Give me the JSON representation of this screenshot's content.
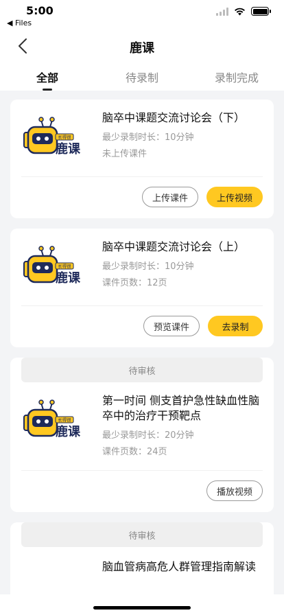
{
  "status": {
    "time": "5:00",
    "back_app": "◀ Files"
  },
  "nav": {
    "title": "鹿课"
  },
  "tabs": [
    {
      "label": "全部",
      "active": true
    },
    {
      "label": "待录制",
      "active": false
    },
    {
      "label": "录制完成",
      "active": false
    }
  ],
  "courses": [
    {
      "review": "",
      "title": "脑卒中课题交流讨论会（下）",
      "meta1": "最少录制时长：10分钟",
      "meta2": "未上传课件",
      "buttons": [
        {
          "label": "上传课件",
          "style": "outline"
        },
        {
          "label": "上传视频",
          "style": "primary"
        }
      ]
    },
    {
      "review": "",
      "title": "脑卒中课题交流讨论会（上）",
      "meta1": "最少录制时长：10分钟",
      "meta2": "课件页数：12页",
      "buttons": [
        {
          "label": "预览课件",
          "style": "outline"
        },
        {
          "label": "去录制",
          "style": "primary"
        }
      ]
    },
    {
      "review": "待审核",
      "title": "第一时间 侧支首护急性缺血性脑卒中的治疗干预靶点",
      "meta1": "最少录制时长：20分钟",
      "meta2": "课件页数：24页",
      "buttons": [
        {
          "label": "播放视频",
          "style": "outline"
        }
      ]
    },
    {
      "review": "待审核",
      "title": "脑血管病高危人群管理指南解读",
      "meta1": "",
      "meta2": "",
      "buttons": []
    }
  ],
  "logo": {
    "badge": "长得很",
    "text": "鹿课",
    "accent": "#ffc821",
    "dark": "#1e2a5a"
  }
}
